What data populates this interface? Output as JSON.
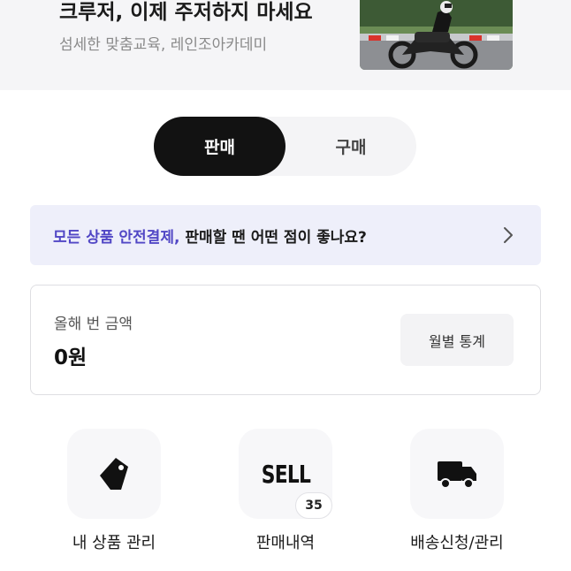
{
  "banner": {
    "title": "크루저, 이제 주저하지 마세요",
    "subtitle": "섬세한 맞춤교육, 레인조아카데미"
  },
  "tabs": {
    "sell_label": "판매",
    "buy_label": "구매",
    "active": "sell"
  },
  "notice": {
    "highlight": "모든 상품 안전결제,",
    "text": " 판매할 땐 어떤 점이 좋나요?"
  },
  "summary": {
    "label": "올해 번 금액",
    "value": "0원",
    "stats_button": "월별 통계"
  },
  "shortcuts": {
    "manage_products": "내 상품 관리",
    "sales_history": "판매내역",
    "sell_icon_text": "SELL",
    "sales_count": "35",
    "shipping": "배송신청/관리"
  },
  "colors": {
    "accent": "#5147c5",
    "active_tab": "#121212",
    "notice_bg": "#eeeffa"
  },
  "icons": {
    "notice": "chevron-right-icon",
    "manage_products": "price-tag-icon",
    "sales_history": "sell-icon",
    "shipping": "delivery-truck-icon"
  }
}
